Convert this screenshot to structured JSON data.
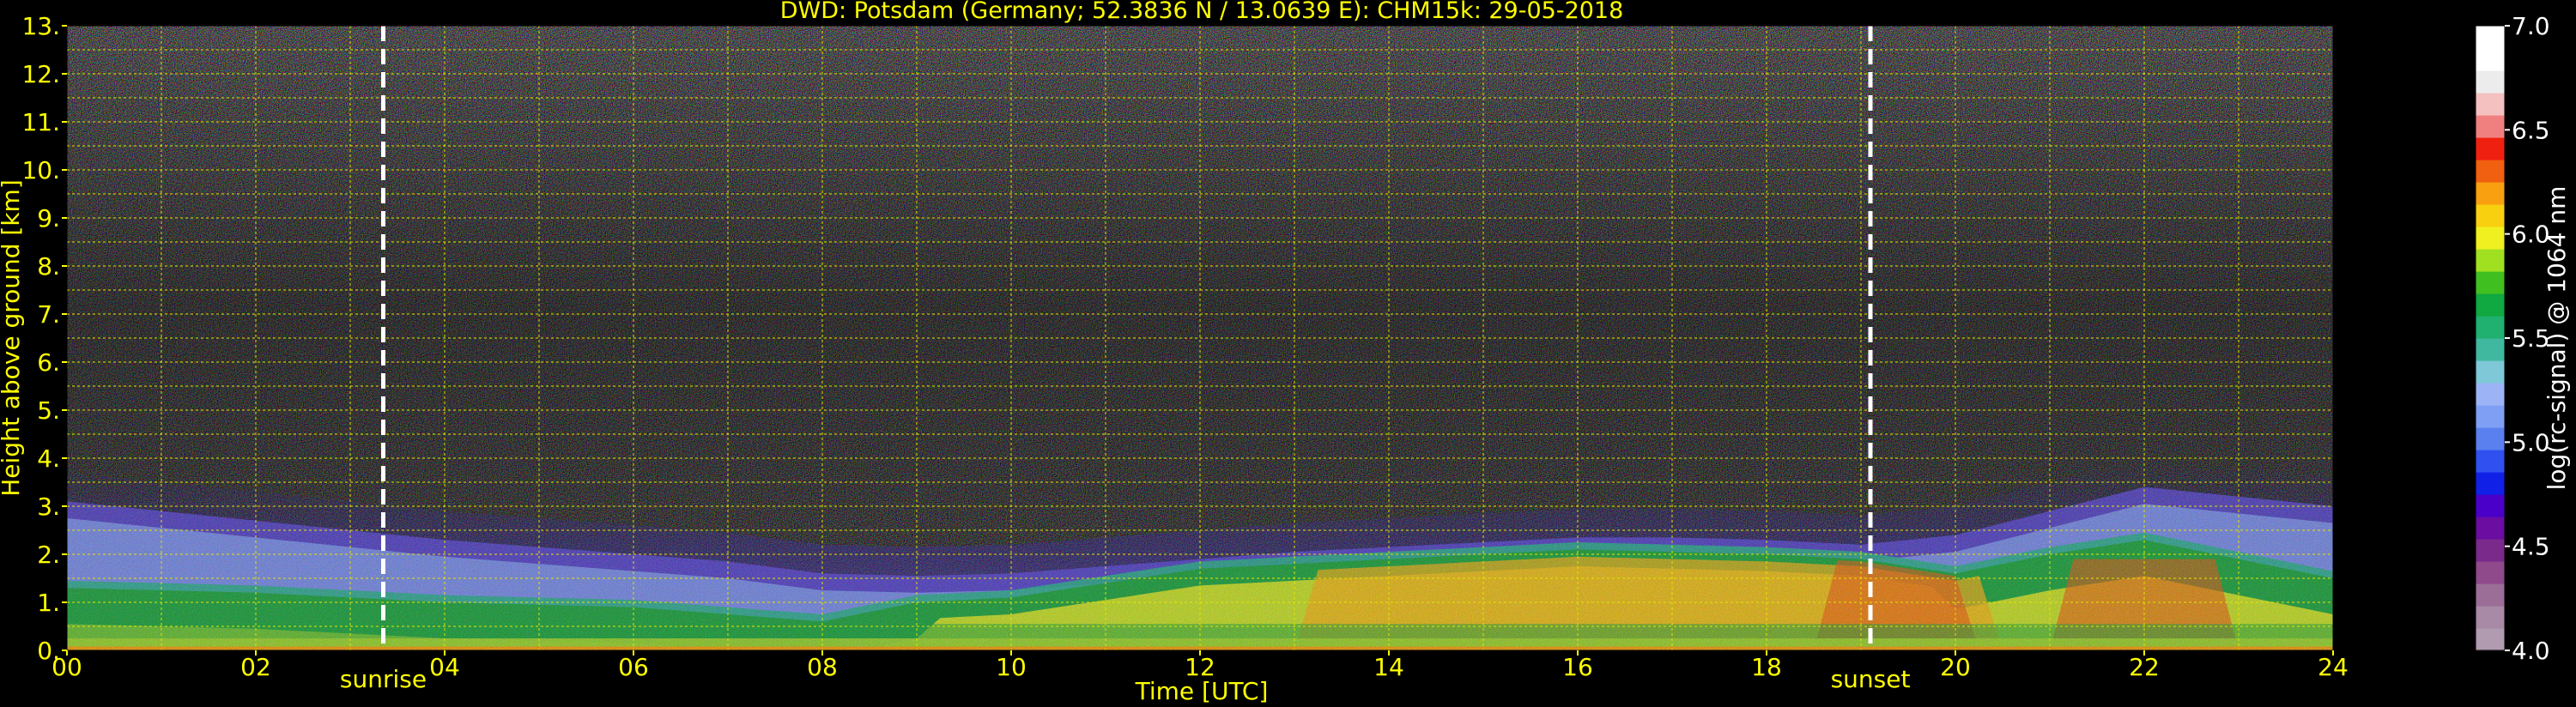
{
  "chart_data": {
    "type": "heatmap",
    "title": "DWD: Potsdam (Germany; 52.3836 N / 13.0639 E):    CHM15k: 29-05-2018",
    "xlabel": "Time [UTC]",
    "ylabel": "Height above ground [km]",
    "xlim": [
      0,
      24
    ],
    "ylim": [
      0,
      13
    ],
    "x_ticks": [
      "00",
      "02",
      "04",
      "06",
      "08",
      "10",
      "12",
      "14",
      "16",
      "18",
      "20",
      "22",
      "24"
    ],
    "y_ticks": [
      "0.",
      "1.",
      "2.",
      "3.",
      "4.",
      "5.",
      "6.",
      "7.",
      "8.",
      "9.",
      "10.",
      "11.",
      "12.",
      "13."
    ],
    "grid": true,
    "events": [
      {
        "label": "sunrise",
        "time_utc": 3.35
      },
      {
        "label": "sunset",
        "time_utc": 19.1
      }
    ],
    "colorbar": {
      "label": "log(rc-signal) @ 1064 nm",
      "range": [
        4.0,
        7.0
      ],
      "ticks": [
        "4.0",
        "4.5",
        "5.0",
        "5.5",
        "6.0",
        "6.5",
        "7.0"
      ]
    },
    "layers": {
      "layer_top_km": [
        [
          0,
          3.1
        ],
        [
          1,
          2.9
        ],
        [
          2,
          2.7
        ],
        [
          3,
          2.5
        ],
        [
          4,
          2.3
        ],
        [
          5,
          2.15
        ],
        [
          6,
          2.0
        ],
        [
          7,
          1.85
        ],
        [
          8,
          1.6
        ],
        [
          9,
          1.55
        ],
        [
          10,
          1.6
        ],
        [
          11,
          1.75
        ],
        [
          12,
          1.9
        ],
        [
          13,
          2.05
        ],
        [
          14,
          2.15
        ],
        [
          15,
          2.25
        ],
        [
          16,
          2.35
        ],
        [
          17,
          2.35
        ],
        [
          18,
          2.3
        ],
        [
          19,
          2.2
        ],
        [
          20,
          2.4
        ],
        [
          21,
          2.9
        ],
        [
          22,
          3.4
        ],
        [
          23,
          3.2
        ],
        [
          24,
          3.0
        ]
      ],
      "aerosol_top_km": [
        [
          0,
          1.3
        ],
        [
          2,
          1.2
        ],
        [
          4,
          1.0
        ],
        [
          6,
          0.9
        ],
        [
          8,
          0.6
        ],
        [
          9,
          1.0
        ],
        [
          10,
          1.1
        ],
        [
          11,
          1.4
        ],
        [
          12,
          1.7
        ],
        [
          13,
          1.8
        ],
        [
          14,
          1.9
        ],
        [
          15,
          2.0
        ],
        [
          16,
          2.1
        ],
        [
          17,
          2.05
        ],
        [
          18,
          2.0
        ],
        [
          19,
          1.9
        ],
        [
          20,
          1.6
        ],
        [
          21,
          2.0
        ],
        [
          22,
          2.3
        ],
        [
          23,
          1.9
        ],
        [
          24,
          1.5
        ]
      ]
    }
  },
  "colors": {
    "annotation_text": "#ffff00",
    "colorbar_text": "#ffffff",
    "grid": "#e6e600",
    "event_line": "#ffffff",
    "colormap": [
      "#b09bb0",
      "#a889a6",
      "#9b6e98",
      "#8e4a8b",
      "#7a2a8a",
      "#6a0da0",
      "#4a00c8",
      "#1020e6",
      "#3050f0",
      "#5a80f0",
      "#7f9ff5",
      "#9cb4f5",
      "#7ec8d8",
      "#40b8a0",
      "#20b070",
      "#10a840",
      "#40c020",
      "#a0e020",
      "#f0f020",
      "#f8d010",
      "#f8a010",
      "#f06010",
      "#f02010",
      "#f08080",
      "#f4c0c0",
      "#ececec",
      "#ffffff",
      "#ffffff"
    ]
  }
}
